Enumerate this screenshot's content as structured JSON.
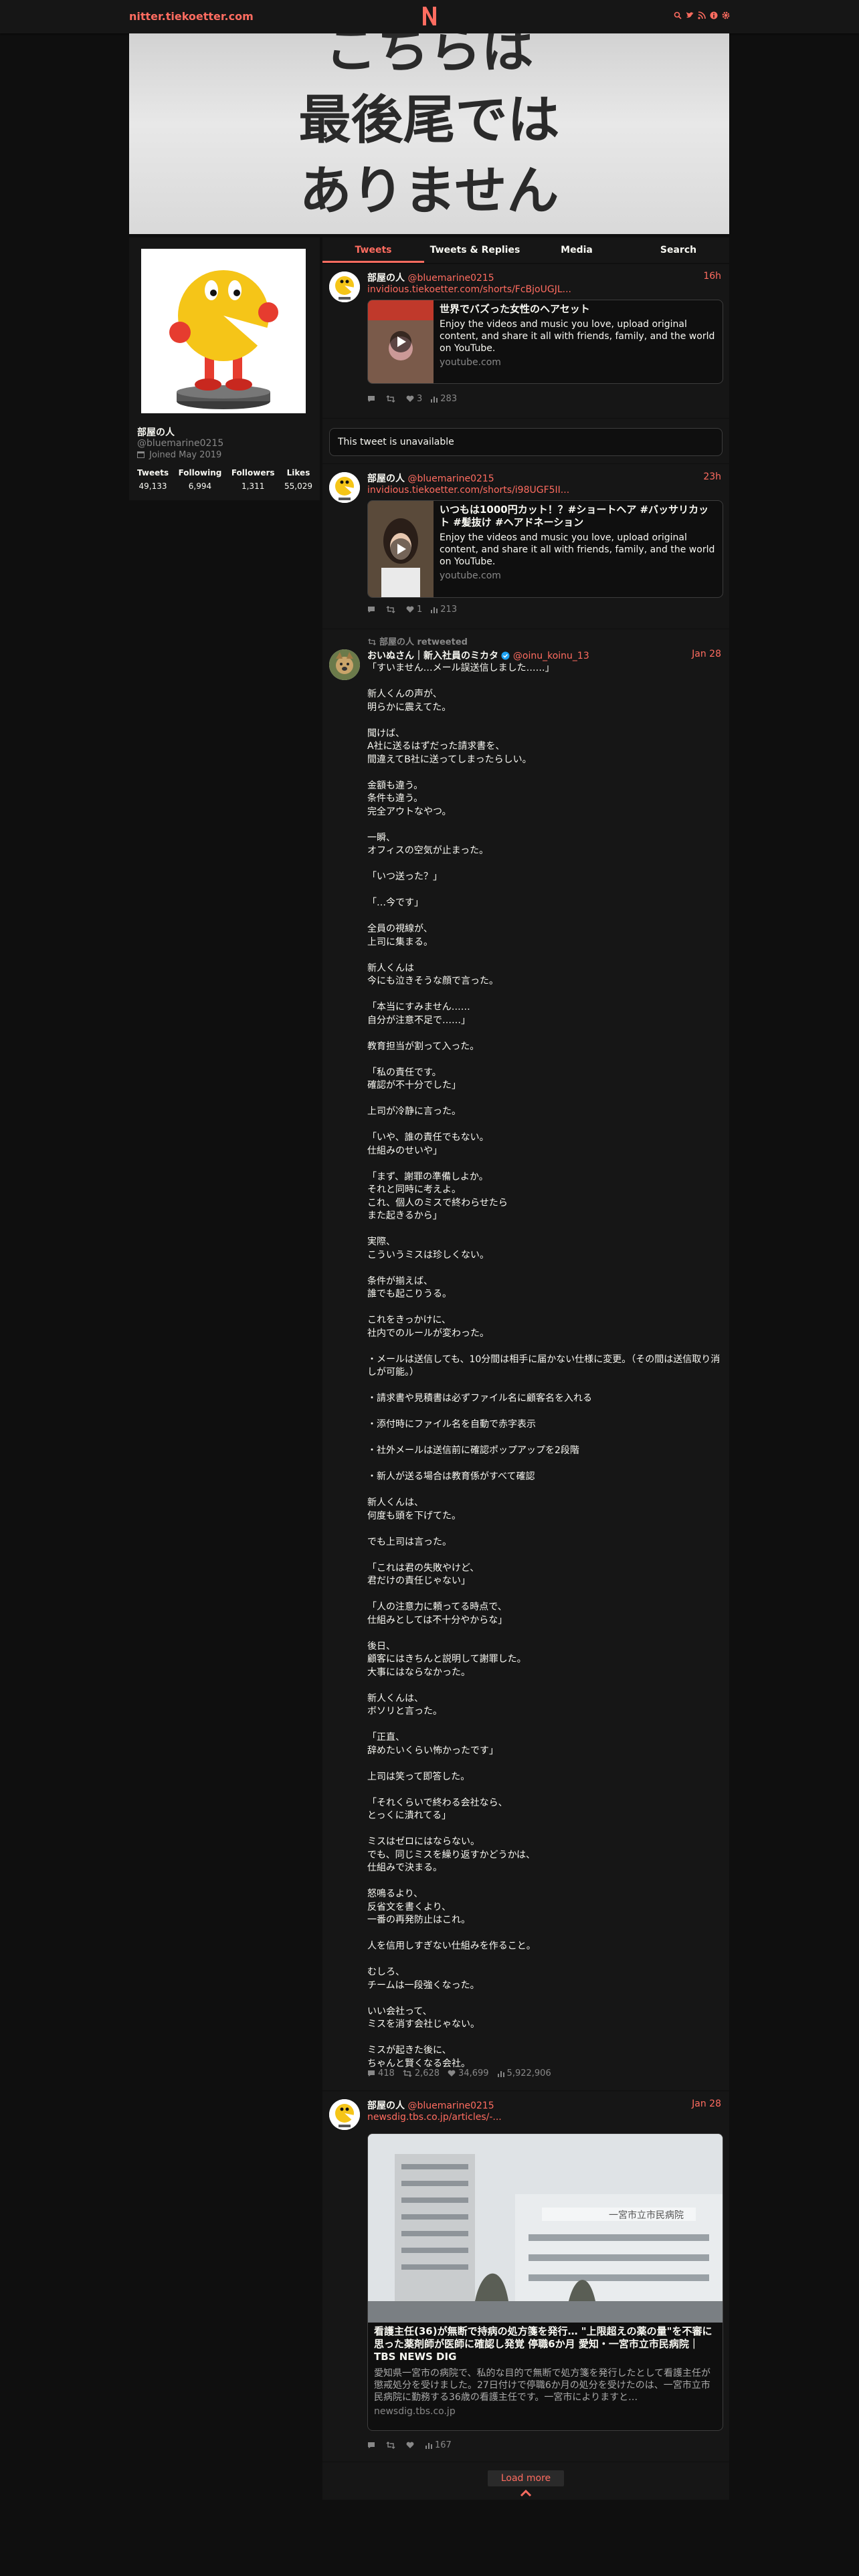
{
  "nav": {
    "site": "nitter.tiekoetter.com",
    "logo": "N",
    "icons": [
      "search-icon",
      "twitter-icon",
      "rss-icon",
      "info-icon",
      "gear-icon"
    ]
  },
  "banner": {
    "lines": [
      "こちらは",
      "最後尾では",
      "ありません"
    ]
  },
  "profile": {
    "name": "部屋の人",
    "handle": "@bluemarine0215",
    "joined": "Joined May 2019",
    "stats": [
      {
        "label": "Tweets",
        "value": "49,133"
      },
      {
        "label": "Following",
        "value": "6,994"
      },
      {
        "label": "Followers",
        "value": "1,311"
      },
      {
        "label": "Likes",
        "value": "55,029"
      }
    ]
  },
  "tabs": [
    "Tweets",
    "Tweets & Replies",
    "Media",
    "Search"
  ],
  "tweets": [
    {
      "name": "部屋の人",
      "handle": "@bluemarine0215",
      "date": "16h",
      "link": "invidious.tiekoetter.com/shorts/FcBjoUGJL...",
      "card": {
        "title": "世界でバズった女性のヘアセット",
        "desc": "Enjoy the videos and music you love, upload original content, and share it all with friends, family, and the world on YouTube.",
        "dest": "youtube.com",
        "thumb_text": "世界でバズった女性のヘアセット"
      },
      "stats": {
        "replies": "",
        "retweets": "",
        "likes": "3",
        "views": "283"
      }
    },
    {
      "unavailable": "This tweet is unavailable"
    },
    {
      "name": "部屋の人",
      "handle": "@bluemarine0215",
      "date": "23h",
      "link": "invidious.tiekoetter.com/shorts/i98UGF5II...",
      "card": {
        "title": "いつもは1000円カット！？#ショートヘア #バッサリカット #髪抜け #ヘアドネーション",
        "desc": "Enjoy the videos and music you love, upload original content, and share it all with friends, family, and the world on YouTube.",
        "dest": "youtube.com",
        "thumb_text": "ヘアドネーション"
      },
      "stats": {
        "replies": "",
        "retweets": "",
        "likes": "1",
        "views": "213"
      }
    },
    {
      "retweet_note": "部屋の人 retweeted",
      "name": "おいぬさん｜新入社員のミカタ",
      "handle": "@oinu_koinu_13",
      "date": "Jan 28",
      "body": "「すいません…メール誤送信しました……」\n\n新人くんの声が、\n明らかに震えてた。\n\n聞けば、\nA社に送るはずだった請求書を、\n間違えてB社に送ってしまったらしい。\n\n金額も違う。\n条件も違う。\n完全アウトなやつ。\n\n一瞬、\nオフィスの空気が止まった。\n\n「いつ送った？」\n\n「…今です」\n\n全員の視線が、\n上司に集まる。\n\n新人くんは\n今にも泣きそうな顔で言った。\n\n「本当にすみません……\n自分が注意不足で……」\n\n教育担当が割って入った。\n\n「私の責任です。\n確認が不十分でした」\n\n上司が冷静に言った。\n\n「いや、誰の責任でもない。\n仕組みのせいや」\n\n「まず、謝罪の準備しよか。\nそれと同時に考えよ。\nこれ、個人のミスで終わらせたら\nまた起きるから」\n\n実際、\nこういうミスは珍しくない。\n\n条件が揃えば、\n誰でも起こりうる。\n\nこれをきっかけに、\n社内でのルールが変わった。\n\n・メールは送信しても、10分間は相手に届かない仕様に変更。（その間は送信取り消しが可能。）\n\n・請求書や見積書は必ずファイル名に顧客名を入れる\n\n・添付時にファイル名を自動で赤字表示\n\n・社外メールは送信前に確認ポップアップを2段階\n\n・新人が送る場合は教育係がすべて確認\n\n新人くんは、\n何度も頭を下げてた。\n\nでも上司は言った。\n\n「これは君の失敗やけど、\n君だけの責任じゃない」\n\n「人の注意力に頼ってる時点で、\n仕組みとしては不十分やからな」\n\n後日、\n顧客にはきちんと説明して謝罪した。\n大事にはならなかった。\n\n新人くんは、\nボソリと言った。\n\n「正直、\n辞めたいくらい怖かったです」\n\n上司は笑って即答した。\n\n「それくらいで終わる会社なら、\nとっくに潰れてる」\n\nミスはゼロにはならない。\nでも、同じミスを繰り返すかどうかは、\n仕組みで決まる。\n\n怒鳴るより、\n反省文を書くより、\n一番の再発防止はこれ。\n\n人を信用しすぎない仕組みを作ること。\n\nむしろ、\nチームは一段強くなった。\n\nいい会社って、\nミスを消す会社じゃない。\n\nミスが起きた後に、\nちゃんと賢くなる会社。",
      "stats": {
        "replies": "418",
        "retweets": "2,628",
        "likes": "34,699",
        "views": "5,922,906"
      }
    },
    {
      "name": "部屋の人",
      "handle": "@bluemarine0215",
      "date": "Jan 28",
      "link": "newsdig.tbs.co.jp/articles/-...",
      "card": {
        "title": "看護主任(36)が無断で持病の処方箋を発行… \"上限超えの薬の量\"を不審に思った薬剤師が医師に確認し発覚 停職6か月 愛知・一宮市立市民病院｜TBS NEWS DIG",
        "desc": "愛知県一宮市の病院で、私的な目的で無断で処方箋を発行したとして看護主任が懲戒処分を受けました。27日付けで停職6か月の処分を受けたのは、一宮市立市民病院に勤務する36歳の看護主任です。一宮市によりますと…",
        "dest": "newsdig.tbs.co.jp",
        "sign": "一宮市立市民病院"
      },
      "stats": {
        "replies": "",
        "retweets": "",
        "likes": "",
        "views": "167"
      }
    }
  ],
  "load_more": "Load more",
  "colors": {
    "accent": "#ff6c60",
    "bg": "#0f0f0f",
    "panel": "#161616",
    "muted": "#888888"
  }
}
